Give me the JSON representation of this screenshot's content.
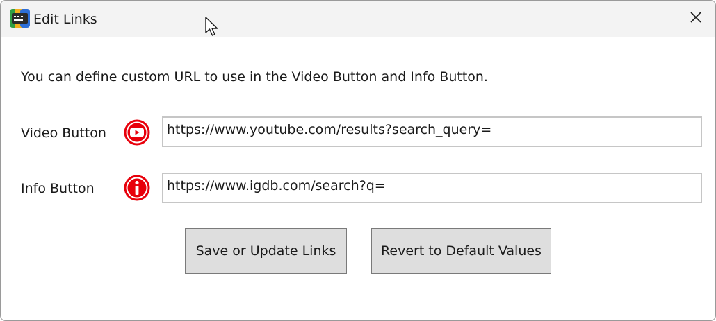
{
  "window": {
    "title": "Edit Links",
    "app_icon": "app-logo-icon",
    "close_icon": "close-icon"
  },
  "description": "You can define custom URL to use in the Video Button and Info Button.",
  "video": {
    "label": "Video Button",
    "icon": "youtube-icon",
    "url": "https://www.youtube.com/results?search_query="
  },
  "info": {
    "label": "Info Button",
    "icon": "info-icon",
    "url": "https://www.igdb.com/search?q="
  },
  "buttons": {
    "save_label": "Save or Update Links",
    "revert_label": "Revert to Default Values"
  },
  "colors": {
    "icon_red": "#e8000b",
    "button_bg": "#dedede",
    "titlebar_bg": "#f3f3f3"
  }
}
